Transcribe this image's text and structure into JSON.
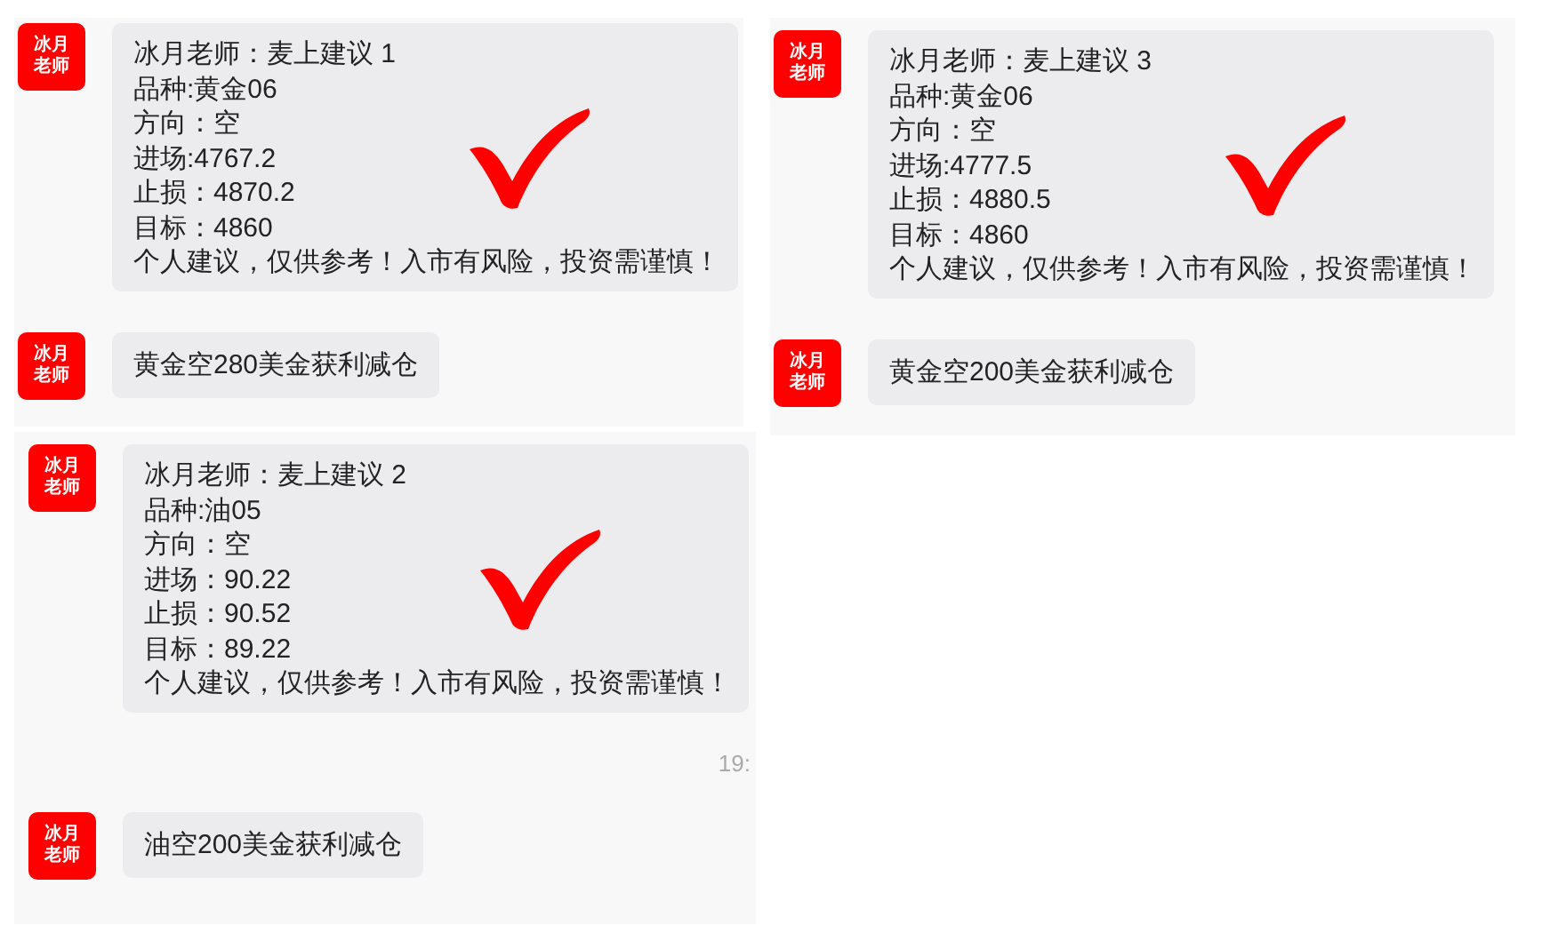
{
  "panels": [
    {
      "messages": [
        {
          "kind": "signal",
          "avatar": "冰月老师",
          "checked": true,
          "lines": [
            "冰月老师：麦上建议 1",
            "品种:黄金06",
            "方向：空",
            "进场:4767.2",
            "止损：4870.2",
            "目标：4860",
            "个人建议，仅供参考！入市有风险，投资需谨慎！"
          ]
        },
        {
          "kind": "text",
          "avatar": "冰月老师",
          "text": "黄金空280美金获利减仓"
        }
      ]
    },
    {
      "messages": [
        {
          "kind": "signal",
          "avatar": "冰月老师",
          "checked": true,
          "lines": [
            "冰月老师：麦上建议 2",
            "品种:油05",
            "方向：空",
            "进场：90.22",
            "止损：90.52",
            "目标：89.22",
            "个人建议，仅供参考！入市有风险，投资需谨慎！"
          ]
        },
        {
          "kind": "time",
          "text": "19:"
        },
        {
          "kind": "text",
          "avatar": "冰月老师",
          "text": "油空200美金获利减仓"
        }
      ]
    },
    {
      "messages": [
        {
          "kind": "signal",
          "avatar": "冰月老师",
          "checked": true,
          "lines": [
            "冰月老师：麦上建议 3",
            "品种:黄金06",
            "方向：空",
            "进场:4777.5",
            "止损：4880.5",
            "目标：4860",
            "个人建议，仅供参考！入市有风险，投资需谨慎！"
          ]
        },
        {
          "kind": "text",
          "avatar": "冰月老师",
          "text": "黄金空200美金获利减仓"
        }
      ]
    }
  ]
}
